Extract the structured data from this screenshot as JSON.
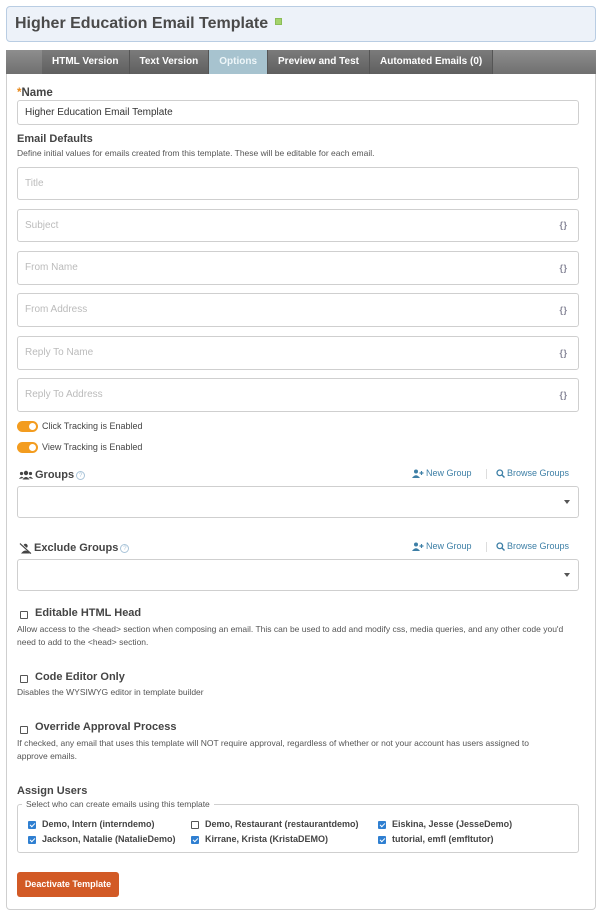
{
  "header": {
    "title": "Higher Education Email Template",
    "status_color": "#a4d36b"
  },
  "tabs": [
    {
      "label": "HTML Version",
      "active": false
    },
    {
      "label": "Text Version",
      "active": false
    },
    {
      "label": "Options",
      "active": true
    },
    {
      "label": "Preview and Test",
      "active": false
    },
    {
      "label": "Automated Emails (0)",
      "active": false
    }
  ],
  "name_field": {
    "required_marker": "*",
    "label": "Name",
    "value": "Higher Education Email Template"
  },
  "email_defaults": {
    "heading": "Email Defaults",
    "help": "Define initial values for emails created from this template. These will be editable for each email.",
    "fields": [
      {
        "placeholder": "Title",
        "value": "",
        "merge_icon": false
      },
      {
        "placeholder": "Subject",
        "value": "",
        "merge_icon": true
      },
      {
        "placeholder": "From Name",
        "value": "",
        "merge_icon": true
      },
      {
        "placeholder": "From Address",
        "value": "",
        "merge_icon": true
      },
      {
        "placeholder": "Reply To Name",
        "value": "",
        "merge_icon": true
      },
      {
        "placeholder": "Reply To Address",
        "value": "",
        "merge_icon": true
      }
    ],
    "merge_icon_glyph": "{ }"
  },
  "tracking": [
    {
      "label": "Click Tracking is Enabled",
      "enabled": true
    },
    {
      "label": "View Tracking is Enabled",
      "enabled": true
    }
  ],
  "groups": {
    "label": "Groups",
    "help_glyph": "?",
    "new_group": "New Group",
    "browse_groups": "Browse Groups",
    "selected": ""
  },
  "exclude_groups": {
    "label": "Exclude Groups",
    "help_glyph": "?",
    "new_group": "New Group",
    "browse_groups": "Browse Groups",
    "selected": ""
  },
  "options": [
    {
      "label": "Editable HTML Head",
      "checked": false,
      "help": "Allow access to the <head> section when composing an email. This can be used to add and modify css, media queries, and any other code you'd need to add to the <head> section."
    },
    {
      "label": "Code Editor Only",
      "checked": false,
      "help": "Disables the WYSIWYG editor in template builder"
    },
    {
      "label": "Override Approval Process",
      "checked": false,
      "help": "If checked, any email that uses this template will NOT require approval, regardless of whether or not your account has users assigned to approve emails."
    }
  ],
  "assign_users": {
    "heading": "Assign Users",
    "legend": "Select who can create emails using this template",
    "users": [
      {
        "label": "Demo, Intern (interndemo)",
        "checked": true
      },
      {
        "label": "Demo, Restaurant (restaurantdemo)",
        "checked": false
      },
      {
        "label": "Eiskina, Jesse (JesseDemo)",
        "checked": true
      },
      {
        "label": "Jackson, Natalie (NatalieDemo)",
        "checked": true
      },
      {
        "label": "Kirrane, Krista (KristaDEMO)",
        "checked": true
      },
      {
        "label": "tutorial, emfl (emfltutor)",
        "checked": true
      }
    ]
  },
  "actions": {
    "deactivate_label": "Deactivate Template",
    "deactivate_color": "#d25a26"
  }
}
